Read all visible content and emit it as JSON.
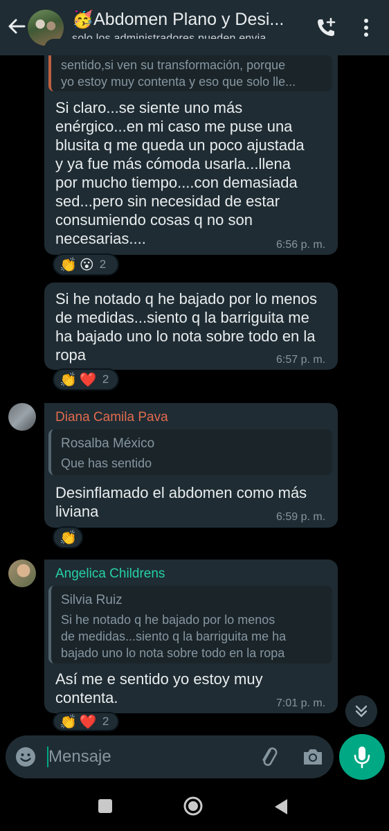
{
  "header": {
    "title": "🥳Abdomen Plano y Desi...",
    "subtitle": "solo los administradores pueden envia..."
  },
  "messages": [
    {
      "quote_text_lines": [
        "sentido,si ven su transformación, porque",
        "yo estoy muy contenta y eso que solo lle..."
      ],
      "text_lines": [
        "Si claro...se siente uno más",
        "enérgico...en mi caso me puse una",
        "blusita q me queda un poco ajustada",
        "y  ya fue más cómoda usarla...llena",
        "por mucho tiempo....con demasiada",
        "sed...pero sin necesidad de estar",
        "consumiendo cosas q no son",
        "necesarias...."
      ],
      "time": "6:56 p. m.",
      "reactions": {
        "emojis": [
          "👏",
          "😮"
        ],
        "count": "2"
      }
    },
    {
      "text_lines": [
        "Si he notado q he bajado por lo menos",
        "de medidas...siento q la barriguita me",
        "ha bajado uno lo nota sobre todo en la",
        "ropa"
      ],
      "time": "6:57 p. m.",
      "reactions": {
        "emojis": [
          "👏",
          "❤️"
        ],
        "count": "2"
      }
    },
    {
      "sender": "Diana Camila Pava",
      "sender_color": "#e26b4f",
      "quote_author": "Rosalba México",
      "quote_text_lines": [
        "Que has sentido"
      ],
      "text_lines": [
        "Desinflamado el abdomen como más",
        "liviana"
      ],
      "time": "6:59 p. m.",
      "reactions": {
        "emojis": [
          "👏"
        ],
        "count": ""
      }
    },
    {
      "sender": "Angelica Childrens",
      "sender_color": "#25d0a8",
      "quote_author": "Silvia Ruiz",
      "quote_text_lines": [
        "Si he notado q he bajado por lo menos",
        "de medidas...siento q la barriguita me ha",
        "bajado uno lo nota sobre todo en la ropa"
      ],
      "text_lines": [
        "Así me e sentido yo estoy muy",
        "contenta."
      ],
      "time": "7:01 p. m.",
      "reactions": {
        "emojis": [
          "👏",
          "❤️"
        ],
        "count": "2"
      }
    }
  ],
  "composer": {
    "placeholder": "Mensaje"
  },
  "colors": {
    "accent": "#00a884",
    "bubble": "#1f2c33",
    "background": "#000000"
  }
}
